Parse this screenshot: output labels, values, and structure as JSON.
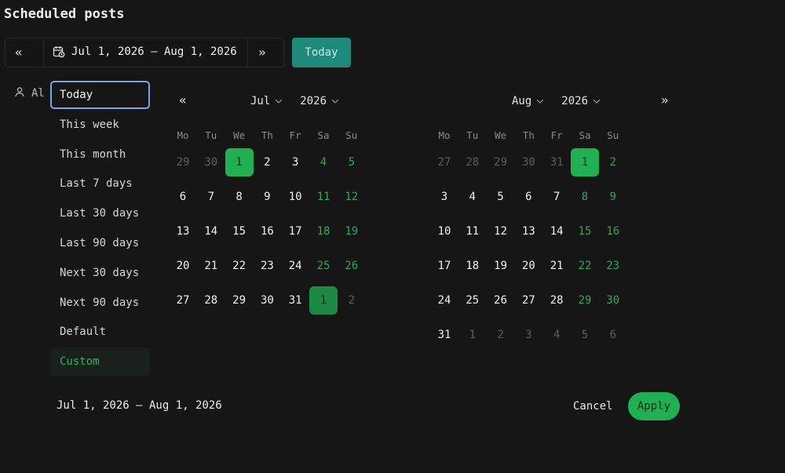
{
  "page": {
    "title": "Scheduled posts"
  },
  "toolbar": {
    "prev_icon": "«",
    "next_icon": "»",
    "range_label": "Jul 1, 2026 – Aug 1, 2026",
    "today_label": "Today"
  },
  "filter": {
    "label": "Al"
  },
  "presets": [
    "Today",
    "This week",
    "This month",
    "Last 7 days",
    "Last 30 days",
    "Last 90 days",
    "Next 30 days",
    "Next 90 days",
    "Default",
    "Custom"
  ],
  "preset_state": {
    "focused": "Today",
    "active": "Custom"
  },
  "calendar": {
    "prev_icon": "«",
    "next_icon": "»",
    "weekdays": [
      "Mo",
      "Tu",
      "We",
      "Th",
      "Fr",
      "Sa",
      "Su"
    ],
    "months": [
      {
        "month": "Jul",
        "year": "2026",
        "weeks": [
          [
            "29",
            "30",
            "1",
            "2",
            "3",
            "4",
            "5"
          ],
          [
            "6",
            "7",
            "8",
            "9",
            "10",
            "11",
            "12"
          ],
          [
            "13",
            "14",
            "15",
            "16",
            "17",
            "18",
            "19"
          ],
          [
            "20",
            "21",
            "22",
            "23",
            "24",
            "25",
            "26"
          ],
          [
            "27",
            "28",
            "29",
            "30",
            "31",
            "1",
            "2"
          ]
        ]
      },
      {
        "month": "Aug",
        "year": "2026",
        "weeks": [
          [
            "27",
            "28",
            "29",
            "30",
            "31",
            "1",
            "2"
          ],
          [
            "3",
            "4",
            "5",
            "6",
            "7",
            "8",
            "9"
          ],
          [
            "10",
            "11",
            "12",
            "13",
            "14",
            "15",
            "16"
          ],
          [
            "17",
            "18",
            "19",
            "20",
            "21",
            "22",
            "23"
          ],
          [
            "24",
            "25",
            "26",
            "27",
            "28",
            "29",
            "30"
          ],
          [
            "31",
            "1",
            "2",
            "3",
            "4",
            "5",
            "6"
          ]
        ]
      }
    ]
  },
  "footer": {
    "range_label": "Jul 1, 2026 – Aug 1, 2026",
    "cancel_label": "Cancel",
    "apply_label": "Apply"
  },
  "colors": {
    "background": "#171616",
    "accent_green": "#1fb052",
    "weekend_green": "#2ba85a",
    "today_teal": "#1d8a7c",
    "focus_ring": "#7fa3e0"
  }
}
